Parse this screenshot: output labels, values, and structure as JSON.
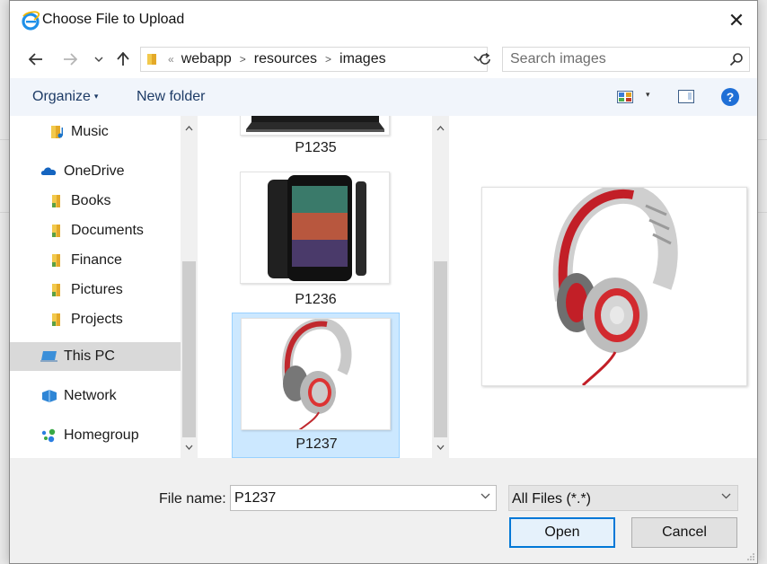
{
  "window": {
    "title": "Choose File to Upload",
    "close_glyph": "✕"
  },
  "address": {
    "overflow_glyph": "«",
    "crumbs": [
      "webapp",
      "resources",
      "images"
    ],
    "search_placeholder": "Search images"
  },
  "toolbar": {
    "organize_label": "Organize",
    "new_folder_label": "New folder",
    "help_glyph": "?"
  },
  "nav": {
    "items": [
      {
        "label": "Music",
        "icon": "music-folder-icon",
        "selected": false
      },
      {
        "label": "OneDrive",
        "icon": "onedrive-icon",
        "selected": false
      },
      {
        "label": "Books",
        "icon": "folder-icon",
        "selected": false
      },
      {
        "label": "Documents",
        "icon": "folder-icon",
        "selected": false
      },
      {
        "label": "Finance",
        "icon": "folder-icon",
        "selected": false
      },
      {
        "label": "Pictures",
        "icon": "folder-icon",
        "selected": false
      },
      {
        "label": "Projects",
        "icon": "folder-icon",
        "selected": false
      },
      {
        "label": "This PC",
        "icon": "computer-icon",
        "selected": true
      },
      {
        "label": "Network",
        "icon": "network-icon",
        "selected": false
      },
      {
        "label": "Homegroup",
        "icon": "homegroup-icon",
        "selected": false
      }
    ]
  },
  "files": [
    {
      "name": "P1235",
      "thumb": "laptop-thumbnail",
      "selected": false
    },
    {
      "name": "P1236",
      "thumb": "tablet-thumbnail",
      "selected": false
    },
    {
      "name": "P1237",
      "thumb": "headphones-thumbnail",
      "selected": true
    }
  ],
  "preview": {
    "image": "headphones-preview"
  },
  "footer": {
    "file_name_label": "File name:",
    "file_name_value": "P1237",
    "file_type": "All Files (*.*)",
    "open_label": "Open",
    "cancel_label": "Cancel"
  },
  "colors": {
    "accent": "#0078d7",
    "toolbar_bg": "#f1f5fb",
    "selection": "#cce8ff",
    "folder": "#f2c94c"
  }
}
